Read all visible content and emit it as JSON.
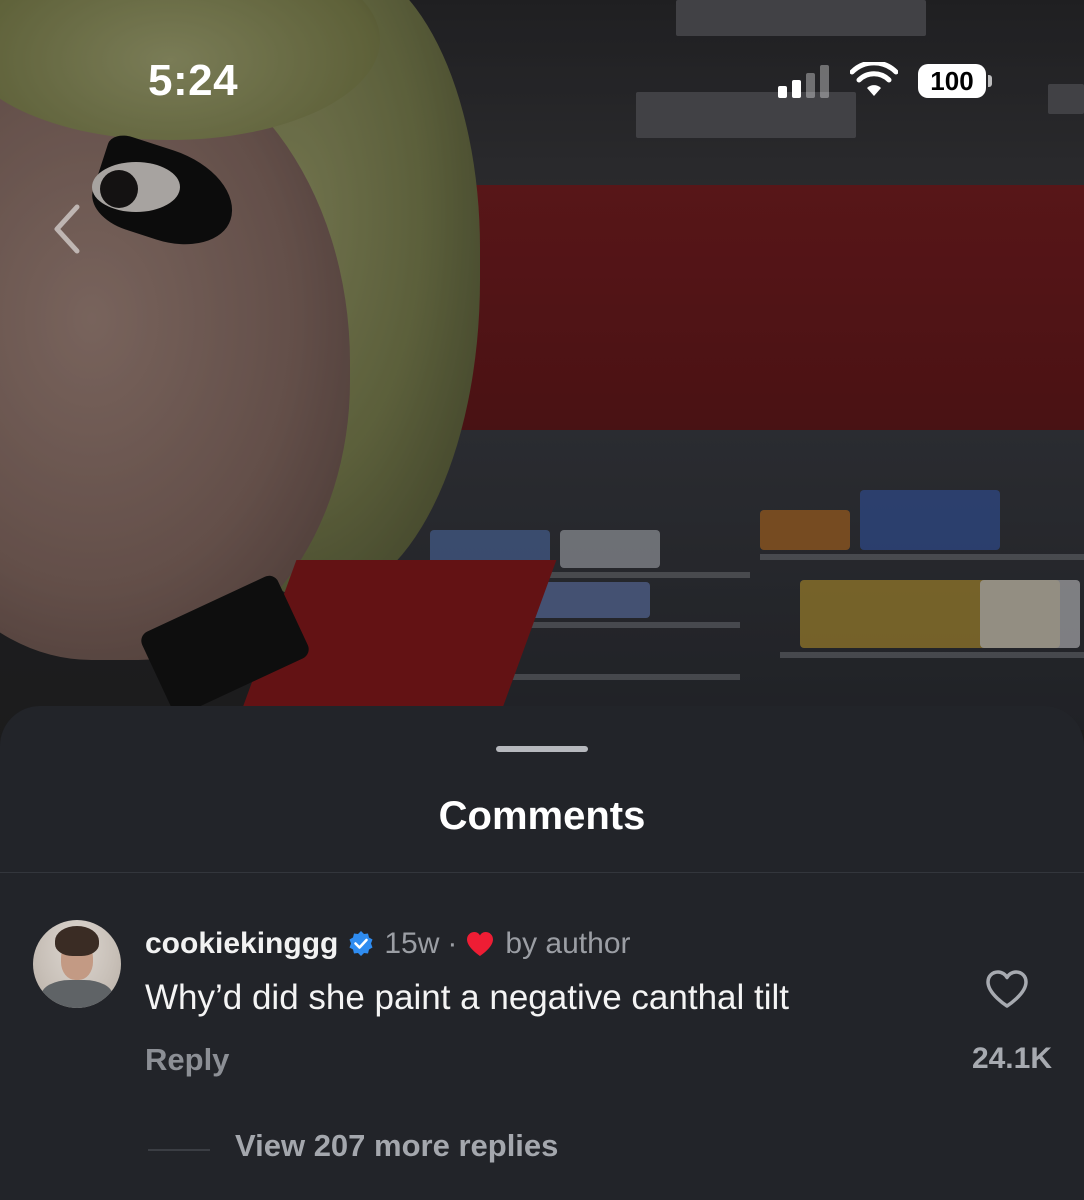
{
  "status_bar": {
    "time": "5:24",
    "battery": "100",
    "signal_bars_active": 2,
    "signal_bars_total": 4
  },
  "navigation": {
    "back_icon": "chevron-left-icon"
  },
  "comments_sheet": {
    "title": "Comments",
    "comments": [
      {
        "username": "cookiekinggg",
        "verified": true,
        "time_ago": "15w",
        "separator": "·",
        "author_liked": "by author",
        "text": "Why’d did she paint a negative canthal tilt",
        "reply_label": "Reply",
        "like_count": "24.1K",
        "view_replies": "View 207 more replies"
      }
    ]
  },
  "colors": {
    "sheet_background": "#222429",
    "secondary_text": "#9b9ea4",
    "verified_blue": "#2f8cf0",
    "heart_red": "#ee1d34"
  }
}
